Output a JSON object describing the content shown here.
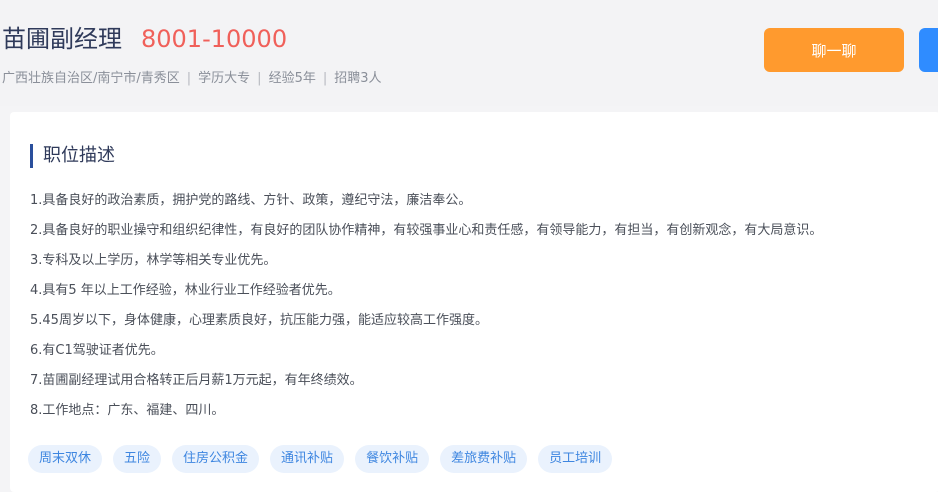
{
  "header": {
    "title": "苗圃副经理",
    "salary": "8001-10000",
    "meta": {
      "location": "广西壮族自治区/南宁市/青秀区",
      "education": "学历大专",
      "experience": "经验5年",
      "headcount": "招聘3人",
      "separator": "|"
    },
    "chat_button": "聊一聊"
  },
  "description": {
    "heading": "职位描述",
    "items": [
      "1.具备良好的政治素质，拥护党的路线、方针、政策，遵纪守法，廉洁奉公。",
      "2.具备良好的职业操守和组织纪律性，有良好的团队协作精神，有较强事业心和责任感，有领导能力，有担当，有创新观念，有大局意识。",
      "3.专科及以上学历，林学等相关专业优先。",
      "4.具有5 年以上工作经验，林业行业工作经验者优先。",
      "5.45周岁以下，身体健康，心理素质良好，抗压能力强，能适应较高工作强度。",
      "6.有C1驾驶证者优先。",
      "7.苗圃副经理试用合格转正后月薪1万元起，有年终绩效。",
      "8.工作地点：广东、福建、四川。"
    ]
  },
  "benefits": [
    "周末双休",
    "五险",
    "住房公积金",
    "通讯补贴",
    "餐饮补贴",
    "差旅费补贴",
    "员工培训"
  ],
  "colors": {
    "salary": "#f0605a",
    "chat_button": "#ff9a2e",
    "apply_button": "#2f8cff",
    "section_accent": "#2a4f9c",
    "tag_text": "#3e86e0",
    "tag_bg": "#eaf2fd"
  }
}
